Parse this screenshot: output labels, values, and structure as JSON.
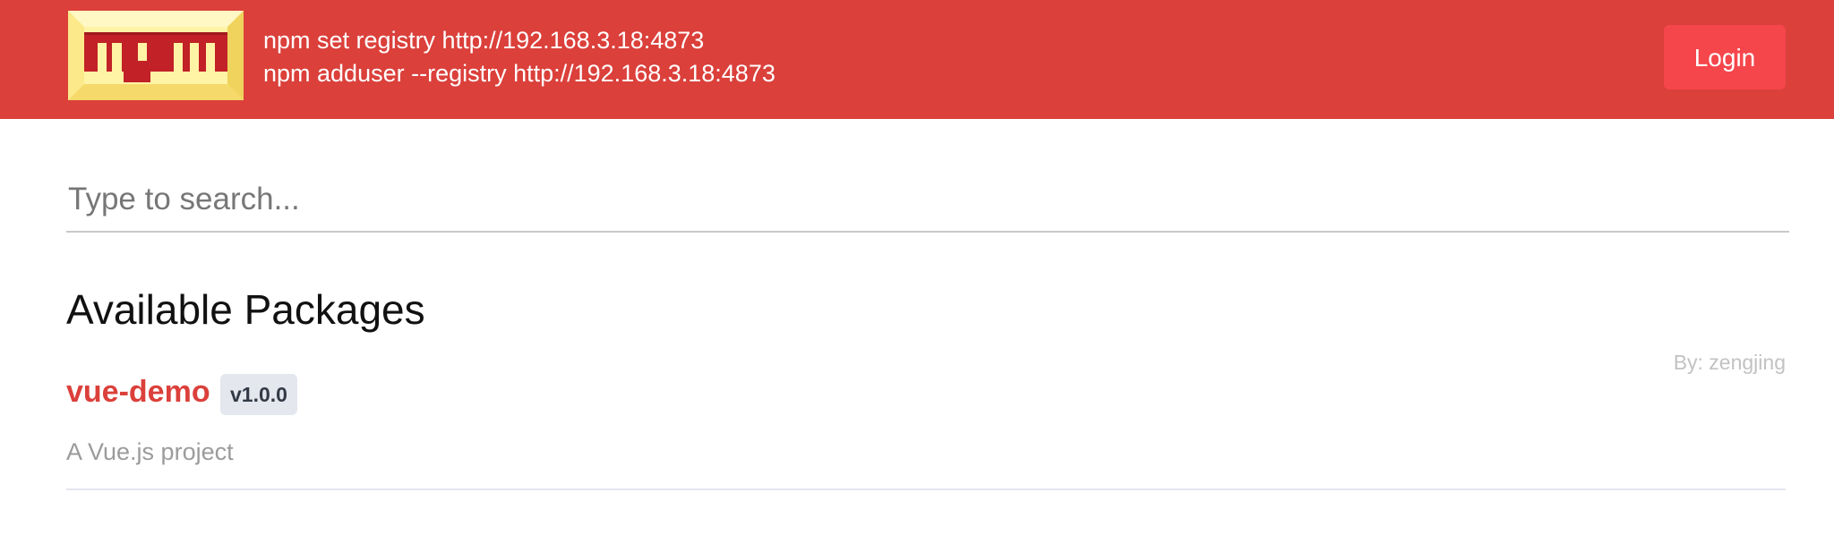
{
  "header": {
    "logo_text": "npm",
    "registry_lines": [
      "npm set registry http://192.168.3.18:4873",
      "npm adduser --registry http://192.168.3.18:4873"
    ],
    "login_label": "Login"
  },
  "search": {
    "placeholder": "Type to search...",
    "value": ""
  },
  "main": {
    "section_title": "Available Packages",
    "packages": [
      {
        "name": "vue-demo",
        "version": "v1.0.0",
        "author": "By: zengjing",
        "description": "A Vue.js project"
      }
    ]
  },
  "colors": {
    "header_bg": "#db403b",
    "login_bg": "#f5464c",
    "package_name": "#db403b",
    "logo_frame": "#ffef8f"
  }
}
